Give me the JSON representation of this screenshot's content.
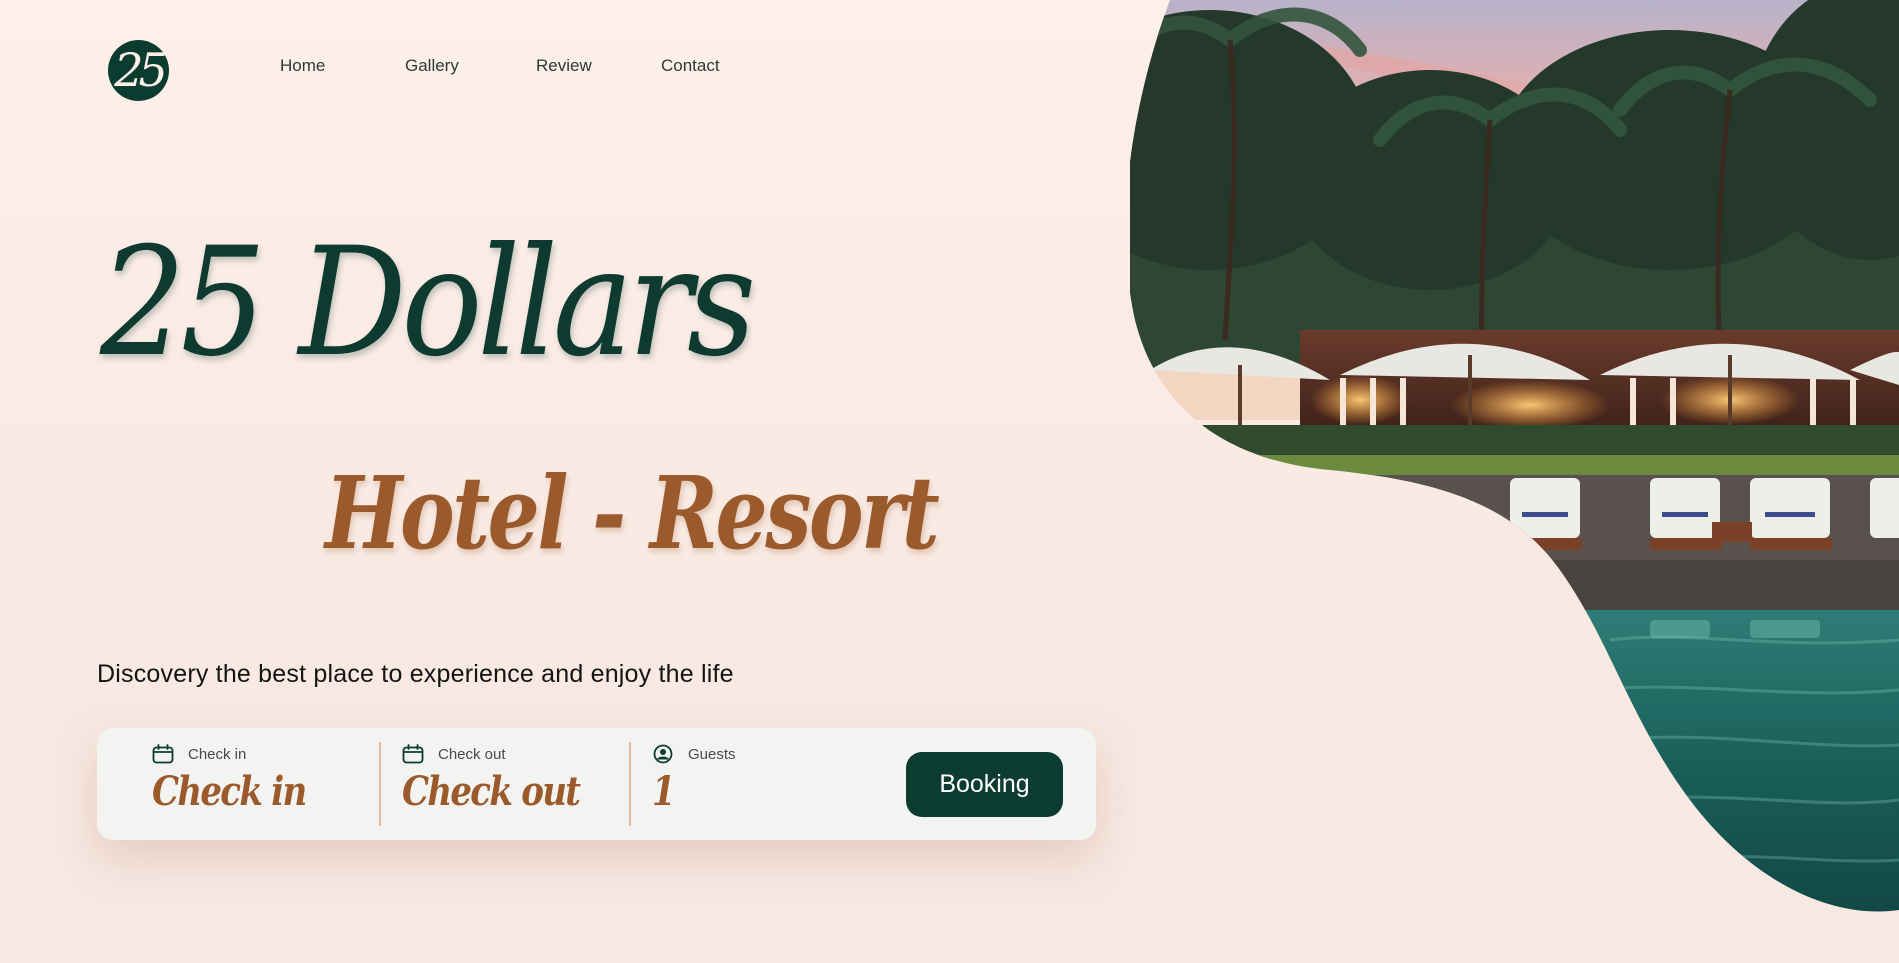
{
  "brand": {
    "logo_text": "25"
  },
  "nav": {
    "items": [
      {
        "label": "Home"
      },
      {
        "label": "Gallery"
      },
      {
        "label": "Review"
      },
      {
        "label": "Contact"
      }
    ]
  },
  "hero": {
    "title": "25 Dollars",
    "subtitle": "Hotel - Resort",
    "tagline": "Discovery the best place to experience and enjoy the life"
  },
  "booking": {
    "check_in": {
      "label": "Check in",
      "value": "Check in",
      "icon": "calendar-icon"
    },
    "check_out": {
      "label": "Check out",
      "value": "Check out",
      "icon": "calendar-icon"
    },
    "guests": {
      "label": "Guests",
      "value": "1",
      "icon": "user-circle-icon"
    },
    "button_label": "Booking"
  },
  "colors": {
    "background": "#fdf0e9",
    "primary": "#0c3b30",
    "accent": "#9b5a2c",
    "bar": "#f3f3f2",
    "divider": "#e5b99e"
  },
  "image": {
    "subject": "resort-pool-palm-trees-photo"
  }
}
